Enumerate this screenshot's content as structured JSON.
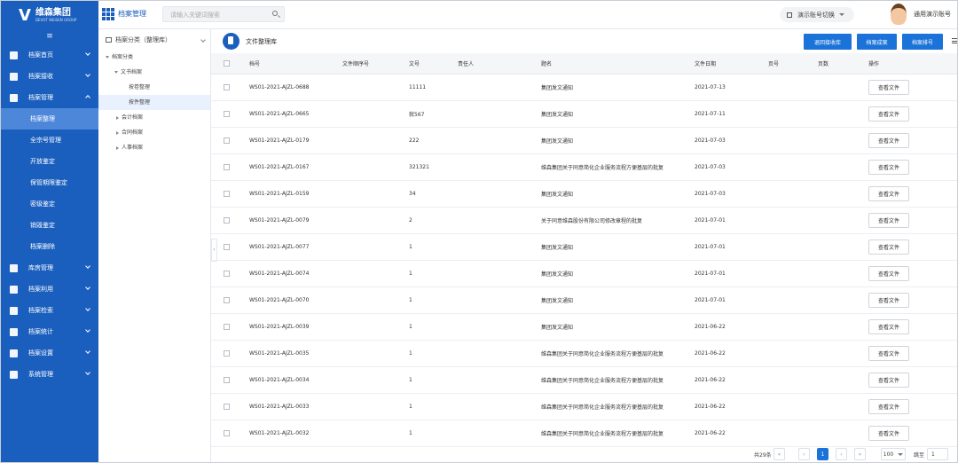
{
  "brand": {
    "name": "维森集团",
    "subtitle": "DEVOT WEISEN GROUP",
    "color": "#1b5fbe"
  },
  "topbar": {
    "module": "档案管理",
    "search_placeholder": "请输入关键词搜索",
    "switch_label": "演示账号切换",
    "user": "通用演示账号"
  },
  "sidebar": {
    "items": [
      {
        "label": "档案首页",
        "icon": "home-icon"
      },
      {
        "label": "档案接收",
        "icon": "receive-icon"
      },
      {
        "label": "档案管理",
        "icon": "layers-icon",
        "expanded": true,
        "children": [
          {
            "label": "档案整理",
            "active": true
          },
          {
            "label": "全宗号管理"
          },
          {
            "label": "开放鉴定"
          },
          {
            "label": "保管期限鉴定"
          },
          {
            "label": "密级鉴定"
          },
          {
            "label": "销毁鉴定"
          },
          {
            "label": "档案删除"
          }
        ]
      },
      {
        "label": "库房管理",
        "icon": "cube-icon"
      },
      {
        "label": "档案利用",
        "icon": "check-icon"
      },
      {
        "label": "档案检索",
        "icon": "search-box-icon"
      },
      {
        "label": "档案统计",
        "icon": "bar-chart-icon"
      },
      {
        "label": "档案设置",
        "icon": "settings-doc-icon"
      },
      {
        "label": "系统管理",
        "icon": "gear-icon"
      }
    ]
  },
  "tree": {
    "header": "档案分类（整理库）",
    "root": "档案分类",
    "doc_archive": "文书档案",
    "doc_children": [
      "按卷整理",
      "按件整理"
    ],
    "others": [
      "会计档案",
      "合同档案",
      "人事档案"
    ]
  },
  "main": {
    "title": "文件整理库",
    "buttons": [
      "退回接收库",
      "档案成案",
      "档案排号"
    ]
  },
  "table": {
    "columns": [
      "档号",
      "文件顺序号",
      "文号",
      "责任人",
      "题名",
      "文件日期",
      "页号",
      "页数",
      "操作"
    ],
    "action_label": "查看文件",
    "rows": [
      {
        "code": "WS01-2021-AJZL-0688",
        "docno": "11111",
        "title": "集团发文通知",
        "date": "2021-07-13"
      },
      {
        "code": "WS01-2021-AJZL-0665",
        "docno": "就567",
        "title": "集团发文通知",
        "date": "2021-07-11"
      },
      {
        "code": "WS01-2021-AJZL-0179",
        "docno": "222",
        "title": "集团发文通知",
        "date": "2021-07-03"
      },
      {
        "code": "WS01-2021-AJZL-0167",
        "docno": "321321",
        "title": "维森集团关于同意简化企业服务流程方便基层的批复",
        "date": "2021-07-03"
      },
      {
        "code": "WS01-2021-AJZL-0159",
        "docno": "34",
        "title": "集团发文通知",
        "date": "2021-07-03"
      },
      {
        "code": "WS01-2021-AJZL-0079",
        "docno": "2",
        "title": "关于同意维森股份有限公司修改章程的批复",
        "date": "2021-07-01"
      },
      {
        "code": "WS01-2021-AJZL-0077",
        "docno": "1",
        "title": "集团发文通知",
        "date": "2021-07-01"
      },
      {
        "code": "WS01-2021-AJZL-0074",
        "docno": "1",
        "title": "集团发文通知",
        "date": "2021-07-01"
      },
      {
        "code": "WS01-2021-AJZL-0070",
        "docno": "1",
        "title": "集团发文通知",
        "date": "2021-07-01"
      },
      {
        "code": "WS01-2021-AJZL-0039",
        "docno": "1",
        "title": "集团发文通知",
        "date": "2021-06-22"
      },
      {
        "code": "WS01-2021-AJZL-0035",
        "docno": "1",
        "title": "维森集团关于同意简化企业服务流程方便基层的批复",
        "date": "2021-06-22"
      },
      {
        "code": "WS01-2021-AJZL-0034",
        "docno": "1",
        "title": "维森集团关于同意简化企业服务流程方便基层的批复",
        "date": "2021-06-22"
      },
      {
        "code": "WS01-2021-AJZL-0033",
        "docno": "1",
        "title": "维森集团关于同意简化企业服务流程方便基层的批复",
        "date": "2021-06-22"
      },
      {
        "code": "WS01-2021-AJZL-0032",
        "docno": "1",
        "title": "维森集团关于同意简化企业服务流程方便基层的批复",
        "date": "2021-06-22"
      }
    ]
  },
  "pagination": {
    "total": "共29条",
    "current": "1",
    "page_size": "100",
    "goto_label": "跳至",
    "goto_value": "1"
  }
}
